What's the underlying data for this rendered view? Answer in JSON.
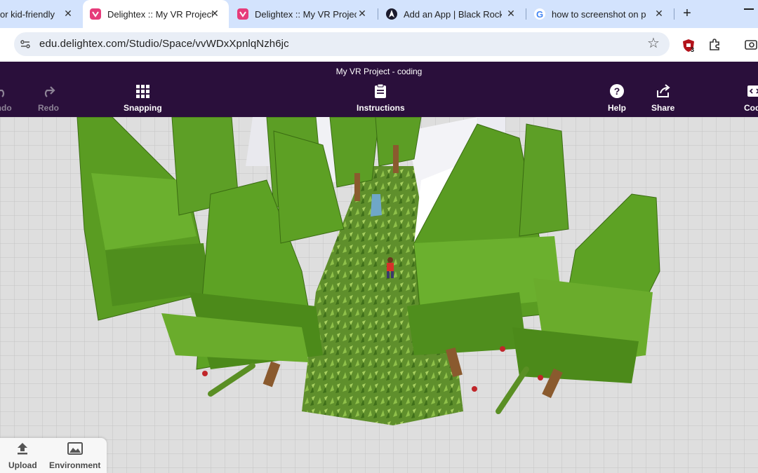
{
  "browser": {
    "tabs": [
      {
        "title": "or kid-friendly",
        "favicon": "generic-page-icon",
        "active": false
      },
      {
        "title": "Delightex :: My VR Project",
        "favicon": "delightex-icon",
        "active": true
      },
      {
        "title": "Delightex :: My VR Project",
        "favicon": "delightex-icon",
        "active": false
      },
      {
        "title": "Add an App | Black Rocket",
        "favicon": "black-rocket-icon",
        "active": false
      },
      {
        "title": "how to screenshot on pc",
        "favicon": "google-icon",
        "active": false
      }
    ],
    "new_tab_label": "+",
    "close_glyph": "✕",
    "url": "edu.delightex.com/Studio/Space/vvWDxXpnlqNzh6jc",
    "extension_badge": "3"
  },
  "app": {
    "project_title": "My VR Project - coding",
    "toolbar": {
      "undo": "Undo",
      "redo": "Redo",
      "snapping": "Snapping",
      "instructions": "Instructions",
      "help": "Help",
      "share": "Share",
      "code": "Code"
    },
    "dock": {
      "upload": "Upload",
      "environment": "Environment"
    }
  },
  "colors": {
    "tab_strip": "#d3e3fd",
    "app_header": "#2a0f3b",
    "tree_green": "#5c9e25",
    "ground": "#dcdcdc"
  }
}
